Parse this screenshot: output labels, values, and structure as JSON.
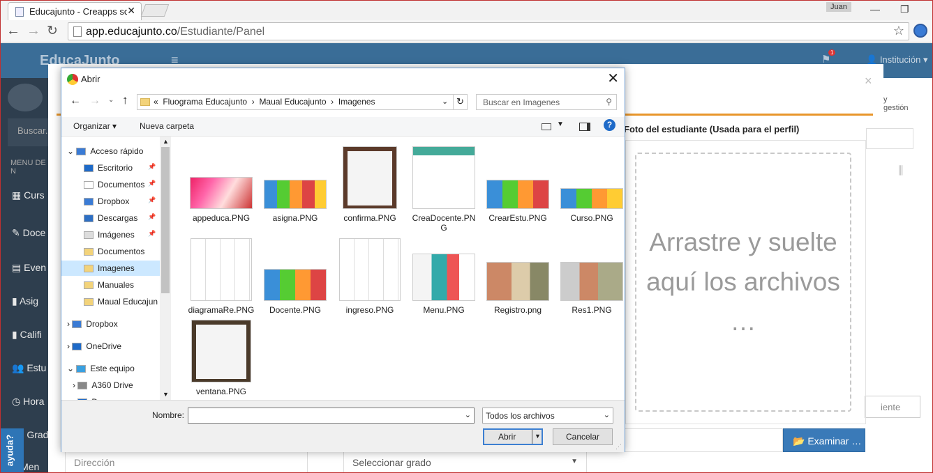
{
  "browser": {
    "tab_title": "Educajunto - Creapps solu",
    "user_badge": "Juan",
    "url_host": "app.educajunto.co",
    "url_path": "/Estudiante/Panel"
  },
  "app": {
    "brand": "EducaJunto",
    "institution_menu": "Institución",
    "notification_count": "1",
    "search_placeholder": "Buscar...",
    "menu_label": "MENU DE N",
    "sidebar_items": [
      "Curs",
      "Doce",
      "Even",
      "Asig",
      "Califi",
      "Estu",
      "Hora",
      "Grad",
      "Men"
    ],
    "help_tab": "ayuda?",
    "photo_title": "Foto del estudiante (Usada para el perfil)",
    "dropzone_text": "Arrastre y suelte aquí los archivos …",
    "browse_button": "Examinar …",
    "address_placeholder": "Dirección",
    "grade_select": "Seleccionar grado",
    "right_partial": "y gestión",
    "right_button_partial": "iente"
  },
  "dialog": {
    "title": "Abrir",
    "breadcrumb": [
      "Fluograma Educajunto",
      "Maual Educajunto",
      "Imagenes"
    ],
    "search_placeholder": "Buscar en Imagenes",
    "organize": "Organizar",
    "new_folder": "Nueva carpeta",
    "nav": {
      "quick_access": "Acceso rápido",
      "quick_items": [
        "Escritorio",
        "Documentos",
        "Dropbox",
        "Descargas",
        "Imágenes",
        "Documentos",
        "Imagenes",
        "Manuales",
        "Maual Educajun"
      ],
      "dropbox": "Dropbox",
      "onedrive": "OneDrive",
      "this_pc": "Este equipo",
      "a360": "A360 Drive",
      "partial": "D"
    },
    "files": [
      "appeduca.PNG",
      "asigna.PNG",
      "confirma.PNG",
      "CreaDocente.PNG",
      "CrearEstu.PNG",
      "Curso.PNG",
      "diagramaRe.PNG",
      "Docente.PNG",
      "ingreso.PNG",
      "Menu.PNG",
      "Registro.png",
      "Res1.PNG",
      "ventana.PNG"
    ],
    "filename_label": "Nombre:",
    "filename_value": "",
    "filetype": "Todos los archivos",
    "open_button": "Abrir",
    "cancel_button": "Cancelar"
  }
}
